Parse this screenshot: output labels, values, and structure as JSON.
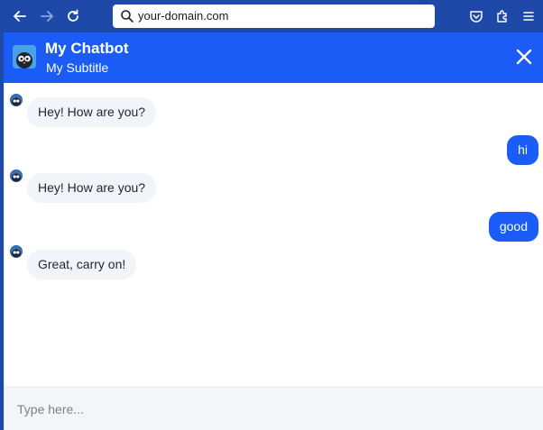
{
  "browser": {
    "url": "your-domain.com"
  },
  "header": {
    "title": "My Chatbot",
    "subtitle": "My Subtitle"
  },
  "messages": [
    {
      "sender": "bot",
      "text": "Hey! How are you?"
    },
    {
      "sender": "user",
      "text": "hi"
    },
    {
      "sender": "bot",
      "text": "Hey! How are you?"
    },
    {
      "sender": "user",
      "text": "good"
    },
    {
      "sender": "bot",
      "text": "Great, carry on!"
    }
  ],
  "input": {
    "placeholder": "Type here..."
  },
  "colors": {
    "brand": "#1a5cf5",
    "browser_bar": "#1e49a8",
    "bot_bubble": "#f1f4f8"
  }
}
